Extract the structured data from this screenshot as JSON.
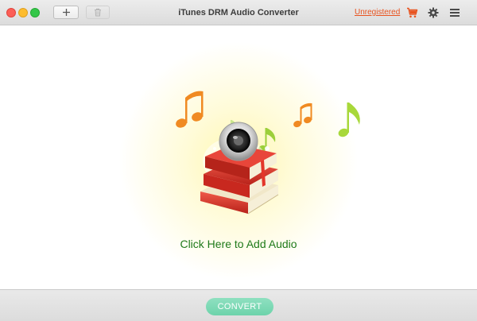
{
  "window": {
    "title": "iTunes DRM Audio Converter",
    "traffic_lights": [
      "close",
      "minimize",
      "zoom"
    ]
  },
  "toolbar": {
    "add_icon": "plus-icon",
    "delete_icon": "trash-icon",
    "unregistered_label": "Unregistered",
    "cart_icon": "shopping-cart-icon",
    "settings_icon": "gear-icon",
    "menu_icon": "hamburger-menu-icon"
  },
  "main": {
    "add_audio_label": "Click Here to Add Audio",
    "illustration_icon": "books-speaker-music-notes-icon"
  },
  "footer": {
    "convert_label": "CONVERT"
  },
  "colors": {
    "accent_green": "#6dd3ab",
    "link_orange": "#e8531f",
    "label_green": "#1f7a1a",
    "glow_yellow": "#fff7b0"
  }
}
